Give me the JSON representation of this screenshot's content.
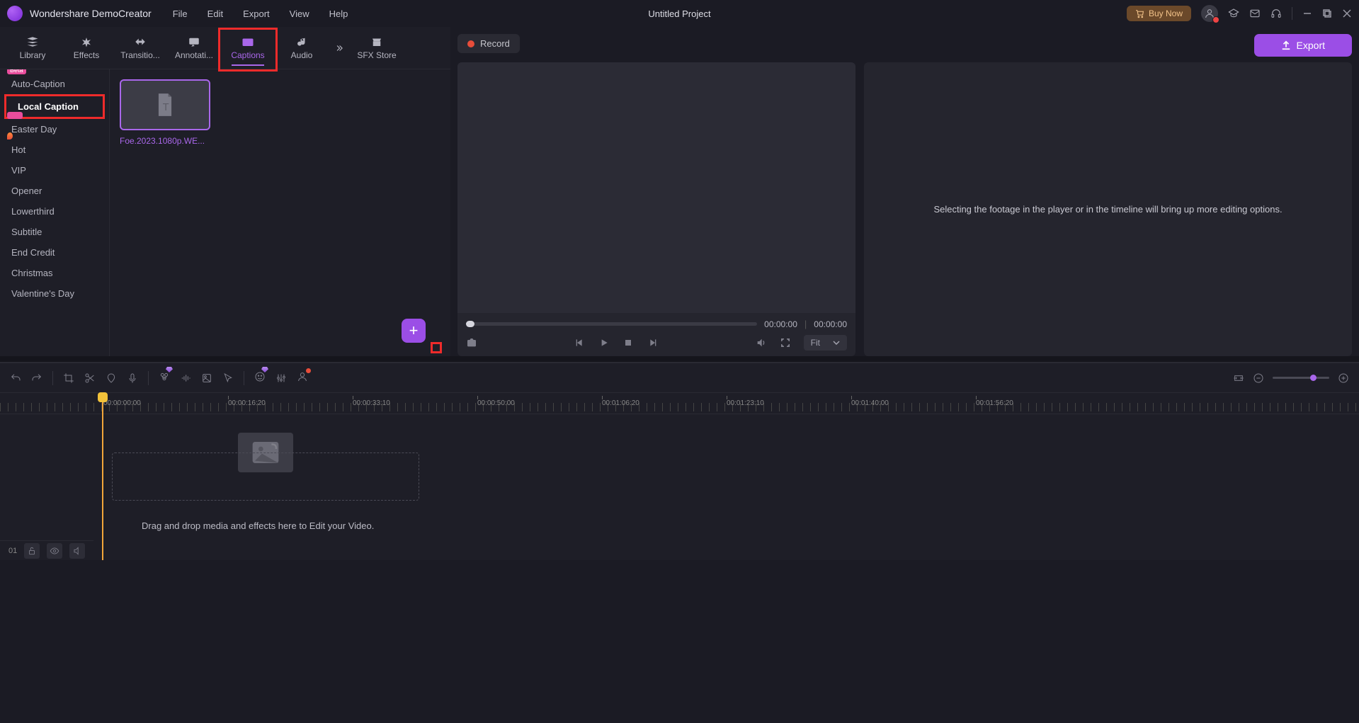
{
  "app": {
    "name": "Wondershare DemoCreator",
    "project": "Untitled Project"
  },
  "menu": [
    "File",
    "Edit",
    "Export",
    "View",
    "Help"
  ],
  "buy_now": "Buy Now",
  "tabs": [
    {
      "id": "library",
      "label": "Library"
    },
    {
      "id": "effects",
      "label": "Effects"
    },
    {
      "id": "transitions",
      "label": "Transitio..."
    },
    {
      "id": "annotations",
      "label": "Annotati..."
    },
    {
      "id": "captions",
      "label": "Captions"
    },
    {
      "id": "audio",
      "label": "Audio"
    },
    {
      "id": "sfx",
      "label": "SFX Store"
    }
  ],
  "sidebar": [
    {
      "label": "Auto-Caption",
      "badge": "Beta"
    },
    {
      "label": "Local Caption",
      "selected": true
    },
    {
      "label": "Easter Day",
      "hotbadge": true
    },
    {
      "label": "Hot",
      "flame": true
    },
    {
      "label": "VIP"
    },
    {
      "label": "Opener"
    },
    {
      "label": "Lowerthird"
    },
    {
      "label": "Subtitle"
    },
    {
      "label": "End Credit"
    },
    {
      "label": "Christmas"
    },
    {
      "label": "Valentine's Day"
    }
  ],
  "thumb": {
    "label": "Foe.2023.1080p.WE..."
  },
  "record": "Record",
  "export": "Export",
  "props_hint": "Selecting the footage in the player or in the timeline will bring up more editing options.",
  "player": {
    "current": "00:00:00",
    "total": "00:00:00",
    "fit": "Fit"
  },
  "timeline": {
    "marks": [
      "00:00:00:00",
      "00:00:16:20",
      "00:00:33:10",
      "00:00:50:00",
      "00:01:06:20",
      "00:01:23:10",
      "00:01:40:00",
      "00:01:56:20"
    ],
    "drop_hint": "Drag and drop media and effects here to Edit your Video.",
    "track_num": "01"
  }
}
